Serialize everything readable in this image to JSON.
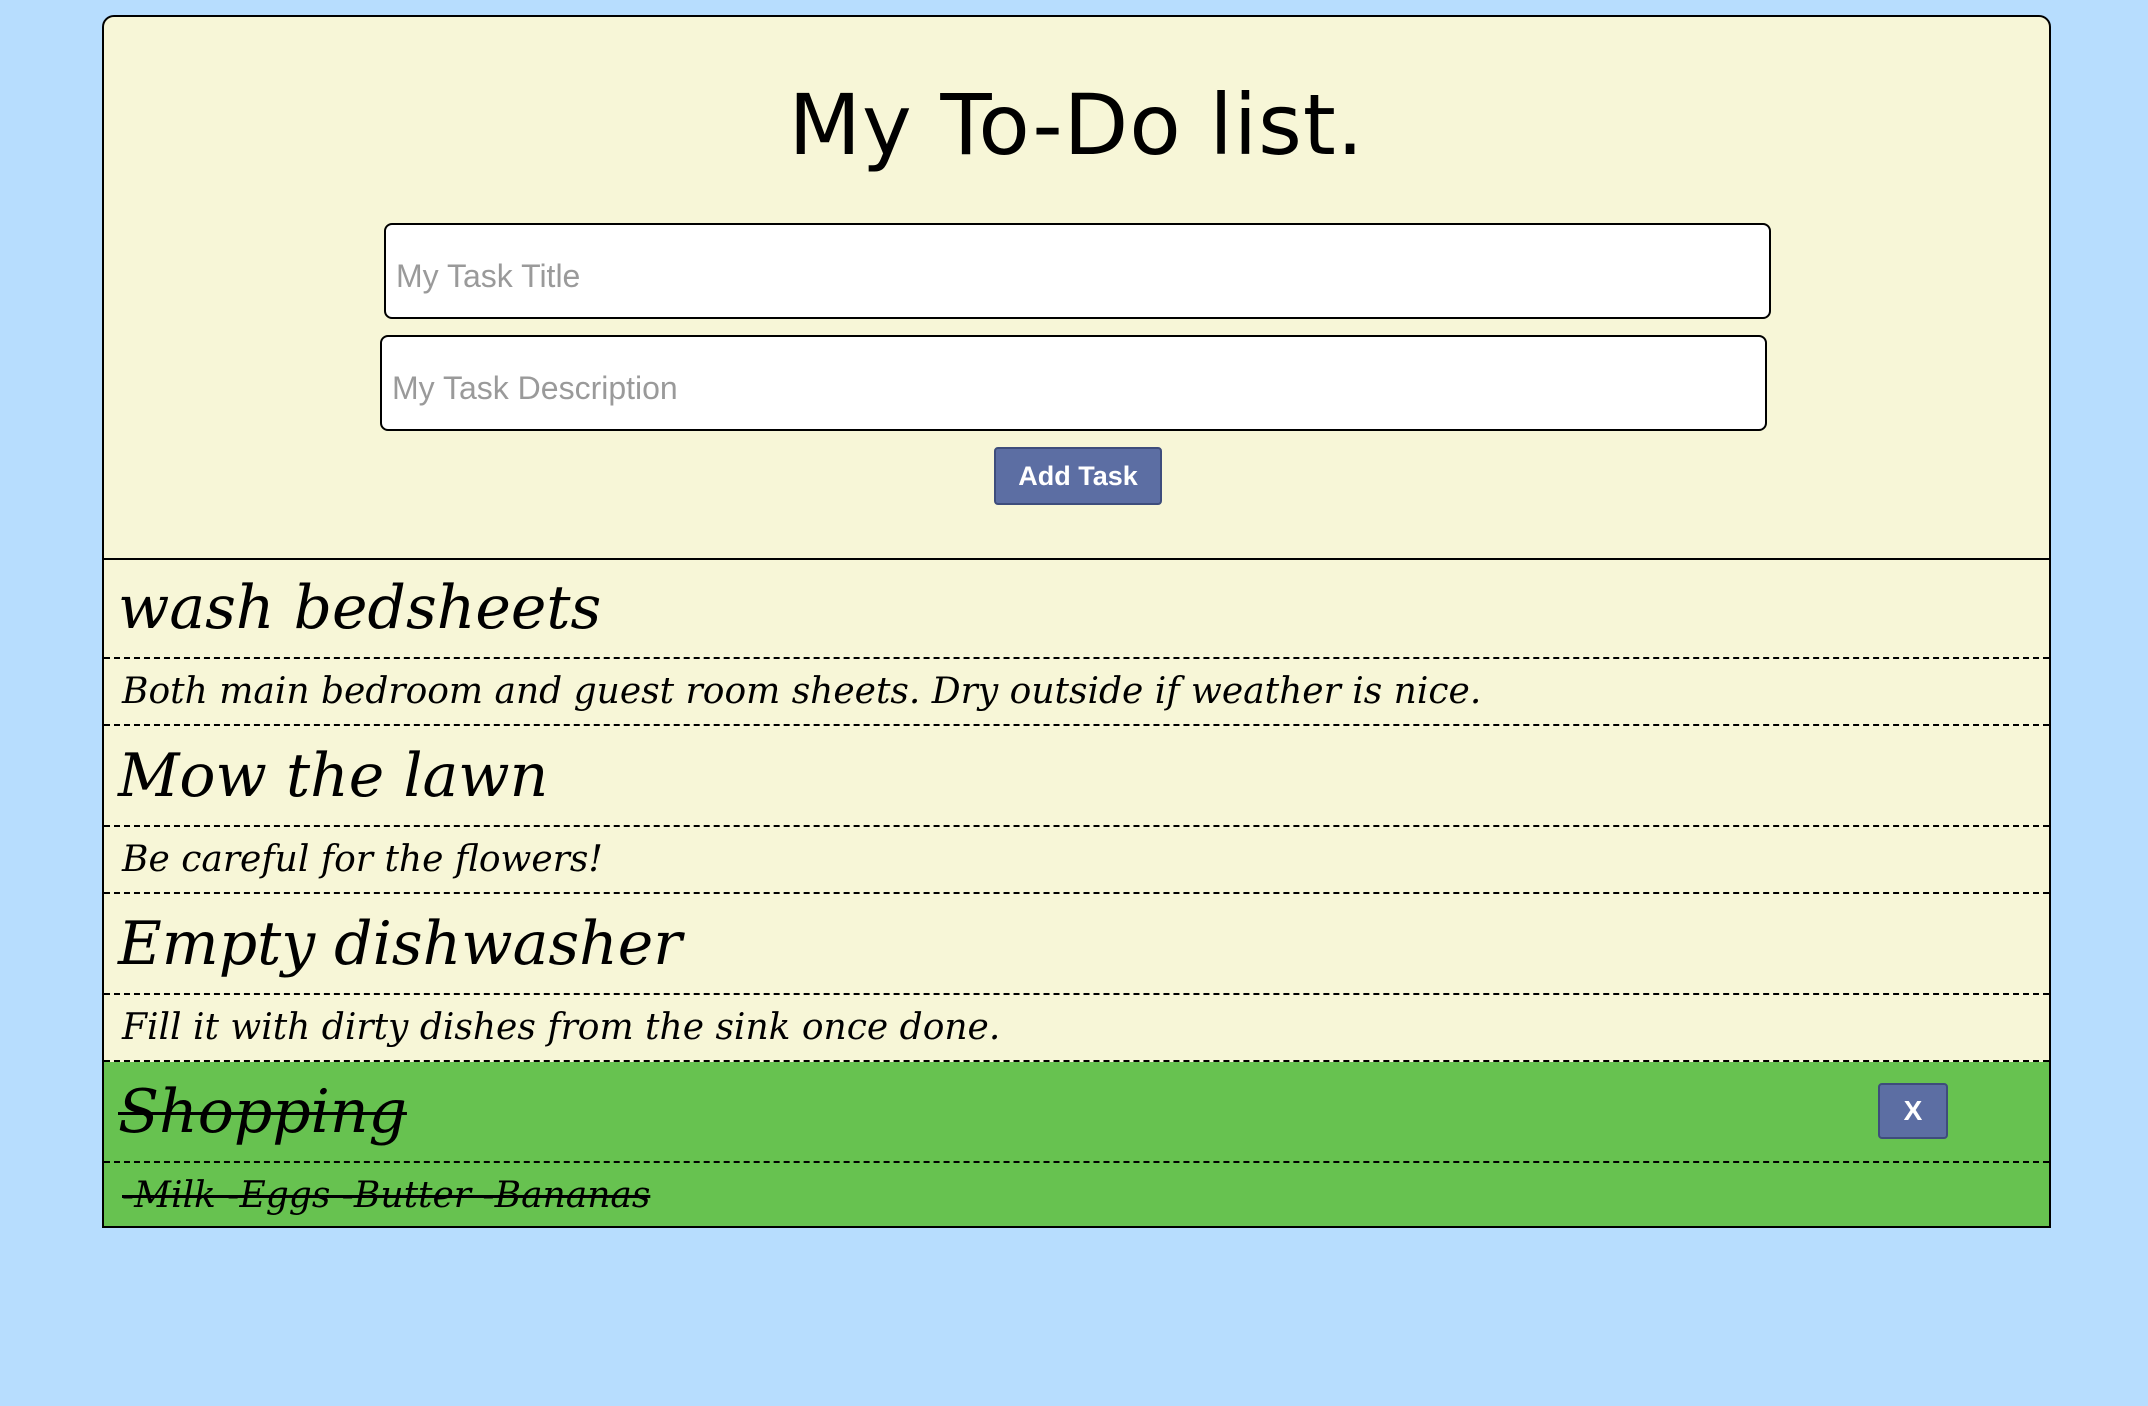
{
  "header": {
    "title": "My To-Do list.",
    "title_placeholder": "My Task Title",
    "description_placeholder": "My Task Description",
    "add_button_label": "Add Task"
  },
  "tasks": [
    {
      "title": "wash bedsheets",
      "description": "Both main bedroom and guest room sheets. Dry outside if weather is nice.",
      "completed": false
    },
    {
      "title": "Mow the lawn",
      "description": "Be careful for the flowers!",
      "completed": false
    },
    {
      "title": "Empty dishwasher",
      "description": "Fill it with dirty dishes from the sink once done.",
      "completed": false
    },
    {
      "title": "Shopping",
      "description": "-Milk -Eggs -Butter -Bananas",
      "completed": true,
      "delete_label": "X"
    }
  ],
  "colors": {
    "page_background": "#b7ddfe",
    "card_background": "#f7f6d7",
    "completed_background": "#67c250",
    "button": "#5c6ea3"
  }
}
